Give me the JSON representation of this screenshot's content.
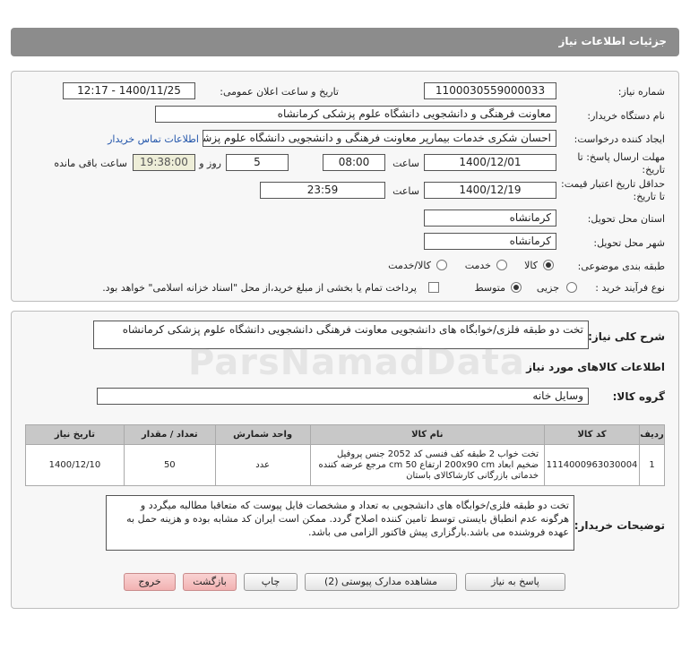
{
  "header": {
    "title": "جزئیات اطلاعات نیاز"
  },
  "fields": {
    "need_number_label": "شماره نیاز:",
    "need_number": "1100030559000033",
    "announce_label": "تاریخ و ساعت اعلان عمومی:",
    "announce_value": "1400/11/25 - 12:17",
    "buyer_org_label": "نام دستگاه خریدار:",
    "buyer_org": "معاونت فرهنگی و دانشجویی دانشگاه علوم پزشکی کرمانشاه",
    "creator_label": "ایجاد کننده درخواست:",
    "creator": "احسان شکری خدمات بیمارپر معاونت فرهنگی و دانشجویی دانشگاه علوم پزشکی",
    "contact_link": "اطلاعات تماس خریدار",
    "deadline_label": "مهلت ارسال پاسخ: تا تاریخ:",
    "deadline_date": "1400/12/01",
    "time_label": "ساعت",
    "deadline_time": "08:00",
    "days": "5",
    "days_label": "روز و",
    "remaining_time": "19:38:00",
    "remaining_label": "ساعت باقی مانده",
    "validity_label": "حداقل تاریخ اعتبار قیمت: تا تاریخ:",
    "validity_date": "1400/12/19",
    "validity_time_label": "ساعت",
    "validity_time": "23:59",
    "province_label": "استان محل تحویل:",
    "province": "کرمانشاه",
    "city_label": "شهر محل تحویل:",
    "city": "کرمانشاه",
    "category_label": "طبقه بندی موضوعی:",
    "category_options": [
      "کالا",
      "خدمت",
      "کالا/خدمت"
    ],
    "purchase_label": "نوع فرآیند خرید :",
    "purchase_options": [
      "جزیی",
      "متوسط"
    ],
    "payment_note": "پرداخت تمام یا بخشی از مبلغ خرید،از محل \"اسناد خزانه اسلامی\" خواهد بود."
  },
  "summary": {
    "label": "شرح کلی نیاز:",
    "value": "تخت دو طبقه فلزی/خوابگاه های دانشجویی معاونت فرهنگی دانشجویی دانشگاه علوم پزشکی کرمانشاه"
  },
  "goods_section": {
    "title": "اطلاعات کالاهای مورد نیاز",
    "group_label": "گروه کالا:",
    "group_value": "وسایل خانه"
  },
  "table": {
    "headers": [
      "ردیف",
      "کد کالا",
      "نام کالا",
      "واحد شمارش",
      "تعداد / مقدار",
      "تاریخ نیاز"
    ],
    "rows": [
      {
        "index": "1",
        "code": "1114000963030004",
        "name": "تخت خواب 2 طبقه کف فنسی کد 2052 جنس پروفیل ضخیم ابعاد 200x90 cm ارتفاع 50 cm مرجع عرضه کننده خدماتی بازرگانی کارشاکالای باستان",
        "unit": "عدد",
        "qty": "50",
        "date": "1400/12/10"
      }
    ]
  },
  "buyer_notes": {
    "label": "توضیحات خریدار:",
    "value": "تخت دو طبقه فلزی/خوابگاه های دانشجویی به تعداد و مشخصات فایل پیوست که متعاقبا مطالبه میگردد و هرگونه عدم انطباق بایستی توسط تامین کننده اصلاح گردد. ممکن است ایران کد مشابه بوده و هزینه حمل به عهده فروشنده می باشد.بارگزاری پیش فاکتور الزامی می باشد."
  },
  "buttons": {
    "reply": "پاسخ به نیاز",
    "attachments": "مشاهده مدارک پیوستی (2)",
    "print": "چاپ",
    "back": "بازگشت",
    "exit": "خروج"
  },
  "watermark": "ParsNamadData"
}
